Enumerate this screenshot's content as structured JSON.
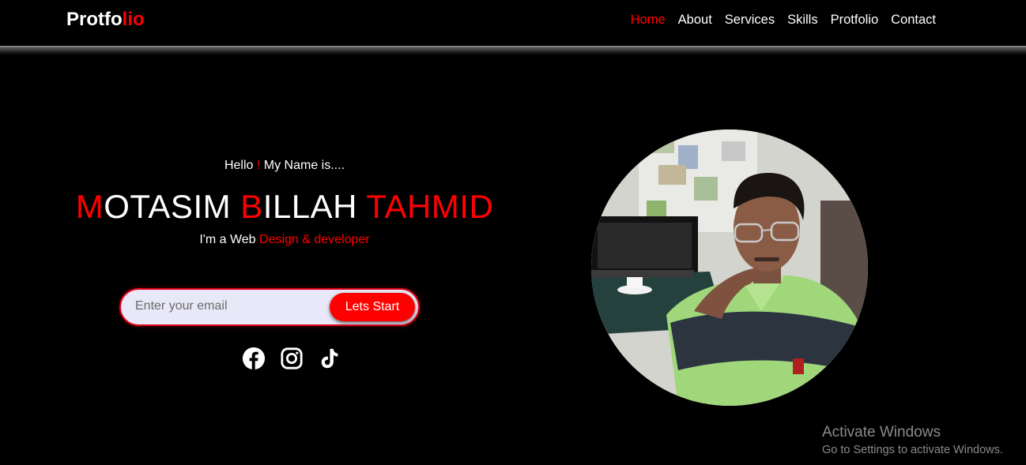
{
  "header": {
    "logo_part1": "Protfo",
    "logo_part2": "lio",
    "nav": [
      {
        "label": "Home",
        "active": true
      },
      {
        "label": "About"
      },
      {
        "label": "Services"
      },
      {
        "label": "Skills"
      },
      {
        "label": "Protfolio"
      },
      {
        "label": "Contact"
      }
    ]
  },
  "hero": {
    "hello_1": "Hello ",
    "hello_bang": "!",
    "hello_2": " My Name is....",
    "name_m": "M",
    "name_1": "OTASIM ",
    "name_b": "B",
    "name_2": "ILLAH ",
    "name_tahmid": "TAHMID",
    "tagline_1": "I'm a Web ",
    "tagline_2": "Design & developer"
  },
  "form": {
    "email_placeholder": "Enter your email",
    "button_label": "Lets Start"
  },
  "socials": [
    "facebook-icon",
    "instagram-icon",
    "tiktok-icon"
  ],
  "watermark": {
    "title": "Activate Windows",
    "subtitle": "Go to Settings to activate Windows."
  },
  "colors": {
    "accent": "#ff0000",
    "background": "#000000",
    "text": "#ffffff"
  }
}
